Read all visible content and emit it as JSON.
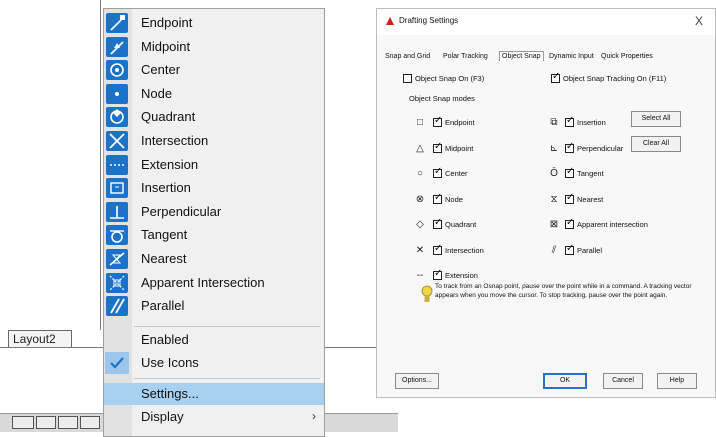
{
  "left_area": {
    "layout_tab": "Layout2"
  },
  "osnap_menu": {
    "items": [
      {
        "label": "Endpoint",
        "icon": "endpoint-snap-icon"
      },
      {
        "label": "Midpoint",
        "icon": "midpoint-snap-icon"
      },
      {
        "label": "Center",
        "icon": "center-snap-icon"
      },
      {
        "label": "Node",
        "icon": "node-snap-icon"
      },
      {
        "label": "Quadrant",
        "icon": "quadrant-snap-icon"
      },
      {
        "label": "Intersection",
        "icon": "intersection-snap-icon"
      },
      {
        "label": "Extension",
        "icon": "extension-snap-icon"
      },
      {
        "label": "Insertion",
        "icon": "insertion-snap-icon"
      },
      {
        "label": "Perpendicular",
        "icon": "perpendicular-snap-icon"
      },
      {
        "label": "Tangent",
        "icon": "tangent-snap-icon"
      },
      {
        "label": "Nearest",
        "icon": "nearest-snap-icon"
      },
      {
        "label": "Apparent Intersection",
        "icon": "apparent-intersection-snap-icon"
      },
      {
        "label": "Parallel",
        "icon": "parallel-snap-icon"
      }
    ],
    "enabled_label": "Enabled",
    "use_icons_label": "Use Icons",
    "use_icons_checked": true,
    "settings_label": "Settings...",
    "display_label": "Display",
    "highlighted_item": "Settings...",
    "highlight_color": "#a8d0f0",
    "icon_color": "#1a73c8"
  },
  "dialog": {
    "title": "Drafting Settings",
    "close_glyph": "X",
    "tabs": [
      "Snap and Grid",
      "Polar Tracking",
      "Object Snap",
      "Dynamic Input",
      "Quick Properties"
    ],
    "active_tab": "Object Snap",
    "object_snap_on_label": "Object Snap On (F3)",
    "object_snap_on": false,
    "object_snap_tracking_label": "Object Snap Tracking On (F11)",
    "object_snap_tracking": true,
    "modes_group_label": "Object Snap modes",
    "modes_left": [
      {
        "label": "Endpoint",
        "checked": true,
        "marker": "□"
      },
      {
        "label": "Midpoint",
        "checked": true,
        "marker": "△"
      },
      {
        "label": "Center",
        "checked": true,
        "marker": "○"
      },
      {
        "label": "Node",
        "checked": true,
        "marker": "⊗"
      },
      {
        "label": "Quadrant",
        "checked": true,
        "marker": "◇"
      },
      {
        "label": "Intersection",
        "checked": true,
        "marker": "✕"
      },
      {
        "label": "Extension",
        "checked": true,
        "marker": "--"
      }
    ],
    "modes_right": [
      {
        "label": "Insertion",
        "checked": true,
        "marker": "⧉"
      },
      {
        "label": "Perpendicular",
        "checked": true,
        "marker": "⊾"
      },
      {
        "label": "Tangent",
        "checked": true,
        "marker": "Ō"
      },
      {
        "label": "Nearest",
        "checked": true,
        "marker": "⧖"
      },
      {
        "label": "Apparent intersection",
        "checked": true,
        "marker": "⊠"
      },
      {
        "label": "Parallel",
        "checked": true,
        "marker": "⫽"
      }
    ],
    "select_all_label": "Select All",
    "clear_all_label": "Clear All",
    "tip_text": "To track from an Osnap point, pause over the point while in a command. A tracking vector appears when you move the cursor. To stop tracking, pause over the point again.",
    "options_label": "Options...",
    "ok_label": "OK",
    "cancel_label": "Cancel",
    "help_label": "Help"
  }
}
